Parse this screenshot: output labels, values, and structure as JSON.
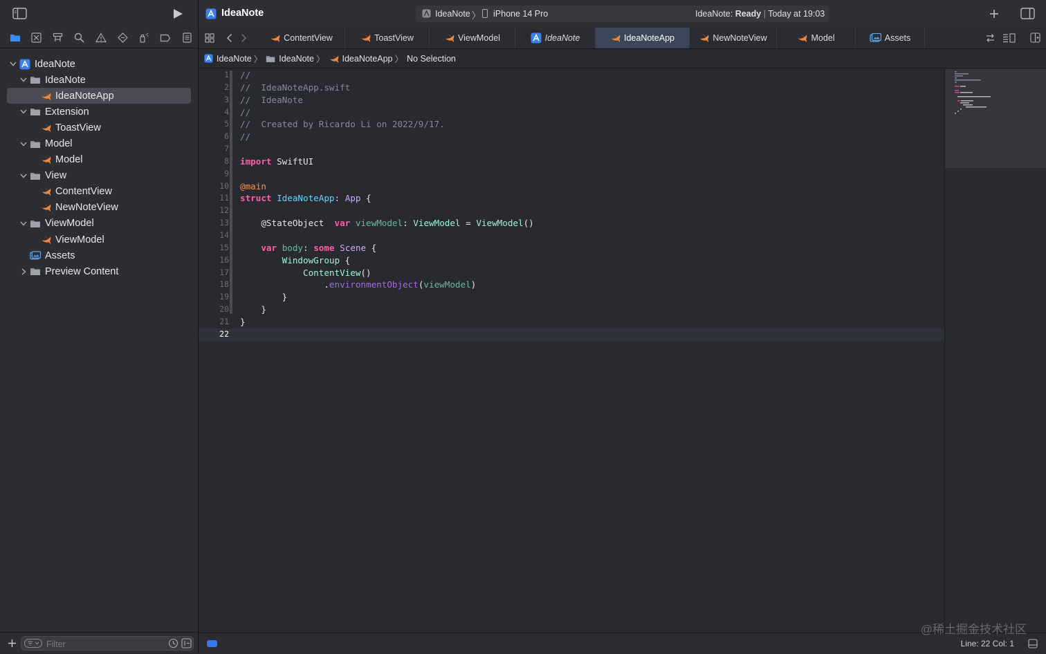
{
  "app": {
    "project_name": "IdeaNote",
    "scheme": "IdeaNote",
    "destination": "iPhone 14 Pro",
    "status_prefix": "IdeaNote:",
    "status_state": "Ready",
    "status_time": "Today at 19:03"
  },
  "navigator": {
    "items": [
      {
        "label": "IdeaNote",
        "icon": "project-icon",
        "expanded": true
      },
      {
        "label": "IdeaNote",
        "icon": "folder-icon",
        "expanded": true
      },
      {
        "label": "IdeaNoteApp",
        "icon": "swift-file-icon",
        "selected": true
      },
      {
        "label": "Extension",
        "icon": "folder-icon",
        "expanded": true
      },
      {
        "label": "ToastView",
        "icon": "swift-file-icon"
      },
      {
        "label": "Model",
        "icon": "folder-icon",
        "expanded": true
      },
      {
        "label": "Model",
        "icon": "swift-file-icon"
      },
      {
        "label": "View",
        "icon": "folder-icon",
        "expanded": true
      },
      {
        "label": "ContentView",
        "icon": "swift-file-icon"
      },
      {
        "label": "NewNoteView",
        "icon": "swift-file-icon"
      },
      {
        "label": "ViewModel",
        "icon": "folder-icon",
        "expanded": true
      },
      {
        "label": "ViewModel",
        "icon": "swift-file-icon"
      },
      {
        "label": "Assets",
        "icon": "asset-catalog-icon"
      },
      {
        "label": "Preview Content",
        "icon": "folder-icon",
        "expanded": false
      }
    ],
    "filter_placeholder": "Filter"
  },
  "tabs": [
    {
      "label": "ContentView",
      "icon": "swift-file-icon"
    },
    {
      "label": "ToastView",
      "icon": "swift-file-icon"
    },
    {
      "label": "ViewModel",
      "icon": "swift-file-icon"
    },
    {
      "label": "IdeaNote",
      "icon": "project-icon",
      "italic": true
    },
    {
      "label": "IdeaNoteApp",
      "icon": "swift-file-icon",
      "active": true
    },
    {
      "label": "NewNoteView",
      "icon": "swift-file-icon"
    },
    {
      "label": "Model",
      "icon": "swift-file-icon"
    },
    {
      "label": "Assets",
      "icon": "asset-catalog-icon"
    }
  ],
  "breadcrumb": [
    "IdeaNote",
    "IdeaNote",
    "IdeaNoteApp",
    "No Selection"
  ],
  "editor": {
    "line_numbers": [
      "1",
      "2",
      "3",
      "4",
      "5",
      "6",
      "7",
      "8",
      "9",
      "10",
      "11",
      "12",
      "13",
      "14",
      "15",
      "16",
      "17",
      "18",
      "19",
      "20",
      "21",
      "22"
    ],
    "current_line": "22",
    "lines": [
      "//",
      "//  IdeaNoteApp.swift",
      "//  IdeaNote",
      "//",
      "//  Created by Ricardo Li on 2022/9/17.",
      "//",
      "",
      "import SwiftUI",
      "",
      "@main",
      "struct IdeaNoteApp: App {",
      "",
      "    @StateObject  var viewModel: ViewModel = ViewModel()",
      "",
      "    var body: some Scene {",
      "        WindowGroup {",
      "            ContentView()",
      "                .environmentObject(viewModel)",
      "        }",
      "    }",
      "}",
      ""
    ]
  },
  "status_bar": {
    "cursor": "Line: 22  Col: 1",
    "watermark": "@稀土掘金技术社区"
  },
  "colors": {
    "background": "#292a30",
    "sidebar": "#2d2e33",
    "selection": "#4b4c53",
    "active_tab": "#3b4658",
    "accent_blue": "#3478f6",
    "swift_orange": "#f0883e",
    "keyword": "#fc5fa3",
    "comment": "#7f8c98",
    "type": "#5dd8ff"
  }
}
